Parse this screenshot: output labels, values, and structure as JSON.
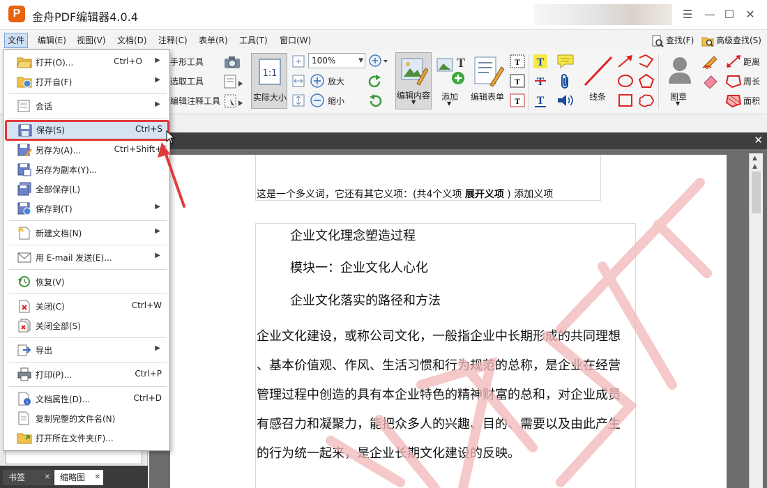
{
  "window": {
    "title": "金舟PDF编辑器4.0.4",
    "logo_text": "P",
    "minimize": "☰",
    "min": "—",
    "max": "☐",
    "close": "✕"
  },
  "menubar": {
    "items": [
      "文件",
      "编辑(E)",
      "视图(V)",
      "文档(D)",
      "注释(C)",
      "表单(R)",
      "工具(T)",
      "窗口(W)"
    ],
    "find": "查找(F)",
    "adv_find": "高级查找(S)"
  },
  "toolbar": {
    "hand_tool": "手形工具",
    "select_tool": "选取工具",
    "edit_annot_tool": "编辑注释工具",
    "actual_size": "实际大小",
    "actual_size_icon_text": "1:1",
    "zoom_value": "100%",
    "zoom_in": "放大",
    "zoom_out": "缩小",
    "edit_content": "编辑内容",
    "add": "添加",
    "edit_form": "编辑表单",
    "lines": "线条",
    "stamp": "图章",
    "distance": "距离",
    "perimeter": "周长",
    "area": "面积"
  },
  "file_menu": {
    "items": [
      {
        "label": "打开(O)...",
        "shortcut": "Ctrl+O",
        "submenu": true,
        "icon": "folder-open-icon"
      },
      {
        "label": "打开自(F)",
        "shortcut": "",
        "submenu": true,
        "icon": "folder-web-icon"
      },
      {
        "label": "会话",
        "shortcut": "",
        "submenu": true,
        "icon": "session-icon"
      },
      {
        "label": "保存(S)",
        "shortcut": "Ctrl+S",
        "submenu": false,
        "icon": "save-icon"
      },
      {
        "label": "另存为(A)...",
        "shortcut": "Ctrl+Shift+S",
        "submenu": false,
        "icon": "save-as-icon"
      },
      {
        "label": "另存为副本(Y)...",
        "shortcut": "",
        "submenu": false,
        "icon": "save-copy-icon"
      },
      {
        "label": "全部保存(L)",
        "shortcut": "",
        "submenu": false,
        "icon": "save-all-icon"
      },
      {
        "label": "保存到(T)",
        "shortcut": "",
        "submenu": true,
        "icon": "save-to-icon"
      },
      {
        "label": "新建文档(N)",
        "shortcut": "",
        "submenu": true,
        "icon": "new-document-icon"
      },
      {
        "label": "用 E-mail 发送(E)...",
        "shortcut": "",
        "submenu": true,
        "icon": "email-icon"
      },
      {
        "label": "恢复(V)",
        "shortcut": "",
        "submenu": false,
        "icon": "restore-icon"
      },
      {
        "label": "关闭(C)",
        "shortcut": "Ctrl+W",
        "submenu": false,
        "icon": "close-doc-icon"
      },
      {
        "label": "关闭全部(S)",
        "shortcut": "",
        "submenu": false,
        "icon": "close-all-icon"
      },
      {
        "label": "导出",
        "shortcut": "",
        "submenu": true,
        "icon": "export-icon"
      },
      {
        "label": "打印(P)...",
        "shortcut": "Ctrl+P",
        "submenu": false,
        "icon": "print-icon"
      },
      {
        "label": "文档属性(D)...",
        "shortcut": "Ctrl+D",
        "submenu": false,
        "icon": "properties-icon"
      },
      {
        "label": "复制完整的文件名(N)",
        "shortcut": "",
        "submenu": false,
        "icon": "copy-filename-icon"
      },
      {
        "label": "打开所在文件夹(F)...",
        "shortcut": "",
        "submenu": false,
        "icon": "open-folder-icon"
      }
    ]
  },
  "left_panel": {
    "tabs": [
      "书签",
      "缩略图"
    ]
  },
  "document": {
    "header_line_prefix": "这是一个多义词，它还有其它义项：(共4个义项 ",
    "header_line_bold": "展开义项",
    "header_line_suffix": " ) 添加义项",
    "lines": [
      "企业文化理念塑造过程",
      "模块一：企业文化人心化",
      "企业文化落实的路径和方法"
    ],
    "paragraph": [
      "企业文化建设，或称公司文化，一般指企业中长期形成的共同理想",
      "、基本价值观、作风、生活习惯和行为规范的总称，是企业在经营",
      "管理过程中创造的具有本企业特色的精神财富的总和，对企业成员",
      "有感召力和凝聚力，能把众多人的兴趣、目的、需要以及由此产生",
      "的行为统一起来，是企业长期文化建设的反映。"
    ]
  },
  "colors": {
    "highlight_border": "#e03b3b",
    "highlight_fill": "#d6e3f3",
    "watermark": "#f2b8b8",
    "doc_tab_strip": "#3f3f3f"
  }
}
